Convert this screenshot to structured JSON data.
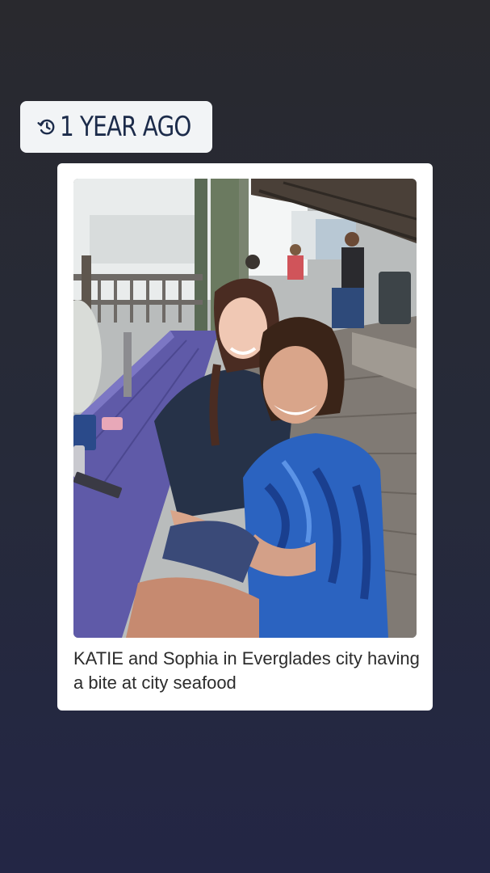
{
  "memory": {
    "label": "1 YEAR AGO",
    "icon": "history-clock-icon",
    "accent": "#1c2b4a"
  },
  "post": {
    "caption": "KATIE and Sophia in Everglades city having a bite at city seafood",
    "photo_alt": "Two girls smiling at a purple picnic table on a wooden dock"
  }
}
